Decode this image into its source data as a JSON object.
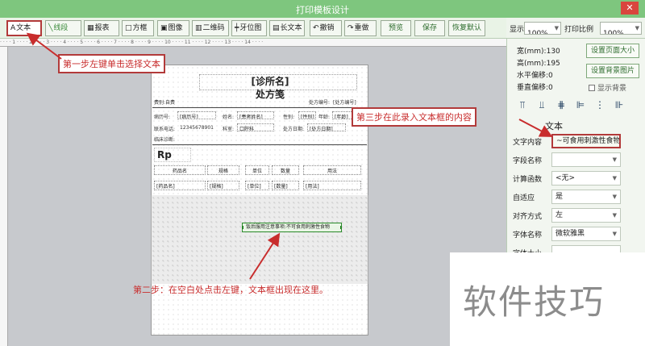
{
  "window": {
    "title": "打印模板设计",
    "close_label": "✕"
  },
  "toolbar": {
    "items": [
      {
        "icon": "A",
        "label": "文本"
      },
      {
        "icon": "╲",
        "label": "线段"
      },
      {
        "icon": "▦",
        "label": "报表"
      },
      {
        "icon": "□",
        "label": "方框"
      },
      {
        "icon": "▣",
        "label": "图像"
      },
      {
        "icon": "▥",
        "label": "二维码"
      },
      {
        "icon": "┿",
        "label": "牙位图"
      },
      {
        "icon": "▤",
        "label": "长文本"
      },
      {
        "icon": "↶",
        "label": "撤销"
      },
      {
        "icon": "↷",
        "label": "重做"
      },
      {
        "icon": "",
        "label": "预览"
      },
      {
        "icon": "",
        "label": "保存"
      },
      {
        "icon": "",
        "label": "恢复默认"
      }
    ]
  },
  "scale": {
    "display_label": "显示比例",
    "display_value": "100%",
    "print_label": "打印比例",
    "print_value": "100%"
  },
  "ruler": {
    "text": "· · · · 1 · · · · 2 · · · · 3 · · · · 4 · · · · 5 · · · · 6 · · · · 7 · · · · 8 · · · · 9 · · · · 10 · · · · 11 · · · · 12 · · · · 13 · · · · 14 · · · ·"
  },
  "template": {
    "title_placeholder": "[诊所名]",
    "title": "处方笺",
    "header_left": "费别:自费",
    "header_right_label": "处方编号:",
    "header_right_value": "[处方编号]",
    "row1": {
      "visit_label": "病历号:",
      "visit_value": "[病历号]",
      "name_label": "姓名:",
      "name_value": "[患者姓名]",
      "sex_label": "性别:",
      "sex_value": "[性别]",
      "age_label": "年龄:",
      "age_value": "[年龄]"
    },
    "row2": {
      "phone_label": "联系电话:",
      "phone_value": "12345678901",
      "dept_label": "科室:",
      "dept_value": "口腔科",
      "date_label": "处方日期:",
      "date_value": "[处方日期]"
    },
    "diagnosis_label": "临床诊断:",
    "rp": "Rp",
    "table_headers": [
      "药品名",
      "规格",
      "单位",
      "数量",
      "用法"
    ],
    "table_values": [
      "[药品名]",
      "[规格]",
      "[单位]",
      "[数量]",
      "[用法]"
    ],
    "new_textbox": "饭后服用注意事项:不可食用刺激性食物"
  },
  "annotations": {
    "step1": "第一步左键单击选择文本",
    "step2": "第二步：在空白处点击左键，文本框出现在这里。",
    "step3": "第三步在此录入文本框的内容"
  },
  "props": {
    "width": "宽(mm):130",
    "height": "高(mm):195",
    "h_offset": "水平偏移:0",
    "v_offset": "垂直偏移:0",
    "set_page_size": "设置页面大小",
    "set_bg_image": "设置背景图片",
    "show_bg": "显示背景",
    "section": "文本",
    "fields": [
      {
        "label": "文字内容",
        "value": "~可食用刺激性食物"
      },
      {
        "label": "字段名称",
        "value": ""
      },
      {
        "label": "计算函数",
        "value": "<无>"
      },
      {
        "label": "自适应",
        "value": "是"
      },
      {
        "label": "对齐方式",
        "value": "左"
      },
      {
        "label": "字体名称",
        "value": "微软雅黑"
      },
      {
        "label": "字体大小",
        "value": ""
      }
    ]
  },
  "watermark": "软件技巧"
}
